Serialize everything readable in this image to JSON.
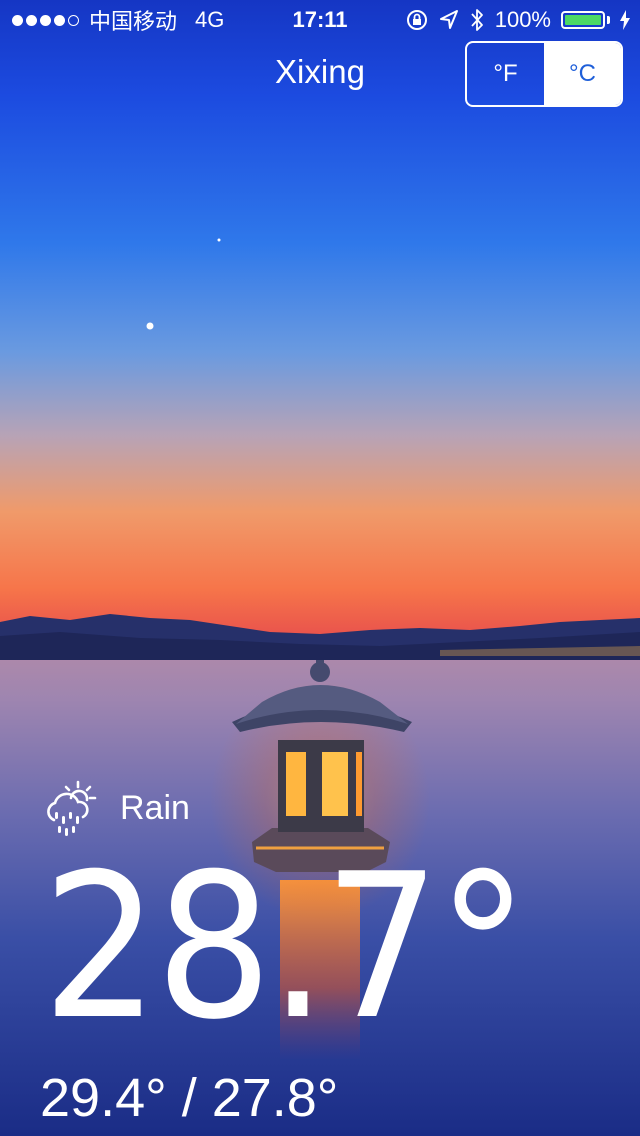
{
  "status_bar": {
    "carrier": "中国移动",
    "network": "4G",
    "time": "17:11",
    "battery": "100%",
    "battery_level": 1.0,
    "battery_color": "#4cd964",
    "signal_bars_filled": 4,
    "signal_bars_total": 5,
    "icons": [
      "rotation-lock-icon",
      "location-arrow-icon",
      "bluetooth-icon",
      "charging-bolt-icon"
    ]
  },
  "header": {
    "city": "Xixing",
    "unit_fahrenheit": "°F",
    "unit_celsius": "°C",
    "selected_unit": "°C"
  },
  "weather": {
    "condition": "Rain",
    "condition_icon": "rain-cloud-sun-icon",
    "temperature": "28.7°",
    "high_low": "29.4° / 27.8°"
  },
  "colors": {
    "toggle_selected_text": "#1f5fd9",
    "sky_top": "#1b48d6",
    "horizon": "#f08a5a"
  }
}
